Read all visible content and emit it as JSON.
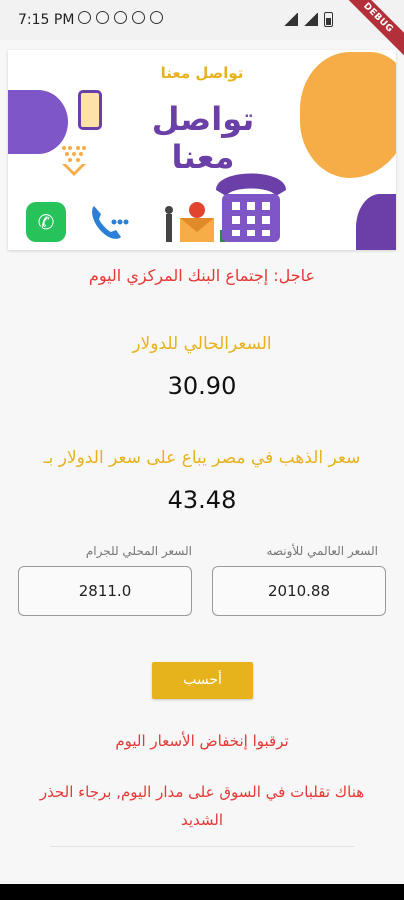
{
  "status_bar": {
    "time": "7:15 PM",
    "debug_label": "DEBUG"
  },
  "banner": {
    "small_title": "تواصل معنا",
    "big_title": "تواصل معنا",
    "whatsapp_color": "#27c25a",
    "accent_purple": "#6b3fa8",
    "accent_orange": "#f7ad47"
  },
  "news": {
    "urgent": "عاجل: إجتماع البنك المركزي اليوم"
  },
  "usd": {
    "label": "السعرالحالي للدولار",
    "value": "30.90"
  },
  "gold_dollar": {
    "label": "سعر الذهب في مصر يباع على سعر الدولار بـ",
    "value": "43.48"
  },
  "fields": {
    "ounce_label": "السعر العالمي للأونصه",
    "ounce_value": "2010.88",
    "gram_label": "السعر المحلي للجرام",
    "gram_value": "2811.0"
  },
  "calc": {
    "label": "أحسب"
  },
  "notices": {
    "expect": "ترقبوا إنخفاض الأسعار اليوم",
    "warning": "هناك تقلبات في السوق على مدار اليوم, برجاء الحذر الشديد"
  },
  "colors": {
    "gold": "#e7b21e",
    "red": "#e53935"
  }
}
